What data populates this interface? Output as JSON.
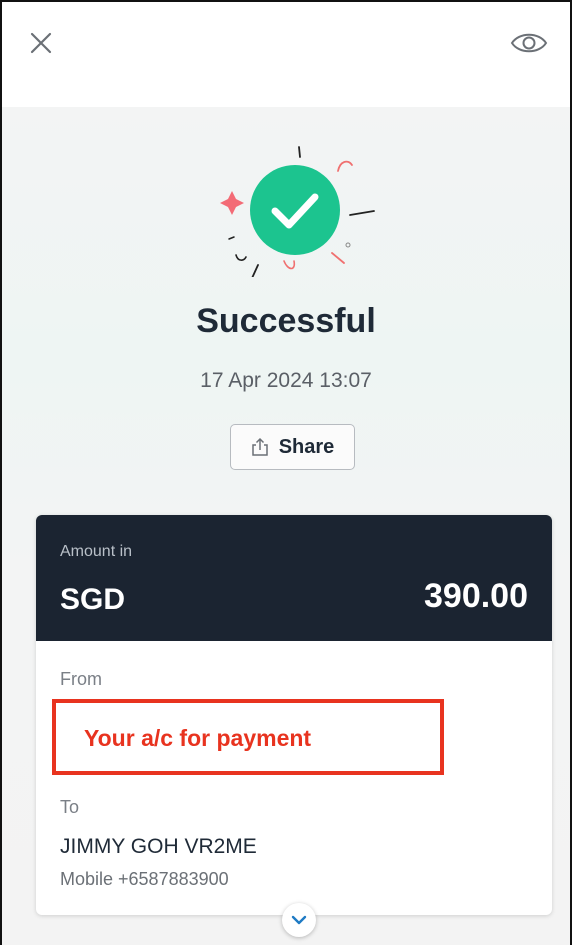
{
  "header": {
    "close_icon": "close-icon",
    "visibility_icon": "eye-icon"
  },
  "status": {
    "title": "Successful",
    "datetime": "17 Apr 2024 13:07",
    "icon": "checkmark-success-icon",
    "accent_color": "#1cc48f"
  },
  "share": {
    "label": "Share",
    "icon": "share-icon"
  },
  "amount": {
    "label": "Amount in",
    "currency": "SGD",
    "value": "390.00"
  },
  "transfer": {
    "from_label": "From",
    "from_value": "Your a/c for payment",
    "to_label": "To",
    "to_name": "JIMMY GOH VR2ME",
    "to_mobile": "Mobile +6587883900"
  },
  "colors": {
    "header_bg": "#1b2431",
    "highlight": "#e8331f",
    "success": "#1cc48f"
  }
}
